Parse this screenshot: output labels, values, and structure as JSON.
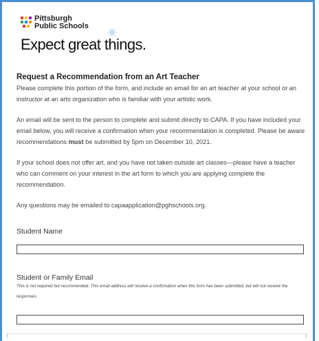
{
  "brand": {
    "logo_text_line1": "Pittsburgh",
    "logo_text_line2": "Public Schools",
    "tagline": "Expect great things.",
    "accent": "#4b8fd3",
    "logo_colors": [
      "#e53935",
      "#fbc02d",
      "#8e24aa",
      "#43a047",
      "#1e88e5",
      "#fb8c00"
    ]
  },
  "form": {
    "title": "Request a Recommendation from an Art Teacher",
    "intro": "Please complete this portion of the form, and include an email for an art teacher at your school or an instructor at an arts organization who is familiar with your artistic work.",
    "email_note_before": "An email will be sent to the person to complete and submit directly to CAPA. If you have included your email below, you will receive a confirmation when your recommendation is completed. Please be aware recommendations ",
    "email_note_bold": "must",
    "email_note_after": " be submitted by 5pm on December 10, 2021.",
    "no_art_note": "If your school does not offer art, and you have not taken outside art classes—please have a teacher who can comment on your interest in the art form to which you are applying complete the recommendation.",
    "questions_note": "Any questions may be emailed to capaapplication@pghschools.org.",
    "fields": {
      "student_name": {
        "label": "Student Name",
        "value": ""
      },
      "family_email": {
        "label": "Student or Family Email",
        "help": "This is not required but recommended. This email address will receive a confirmation when this form has been submitted, but will not receive the responses.",
        "value": ""
      }
    }
  }
}
